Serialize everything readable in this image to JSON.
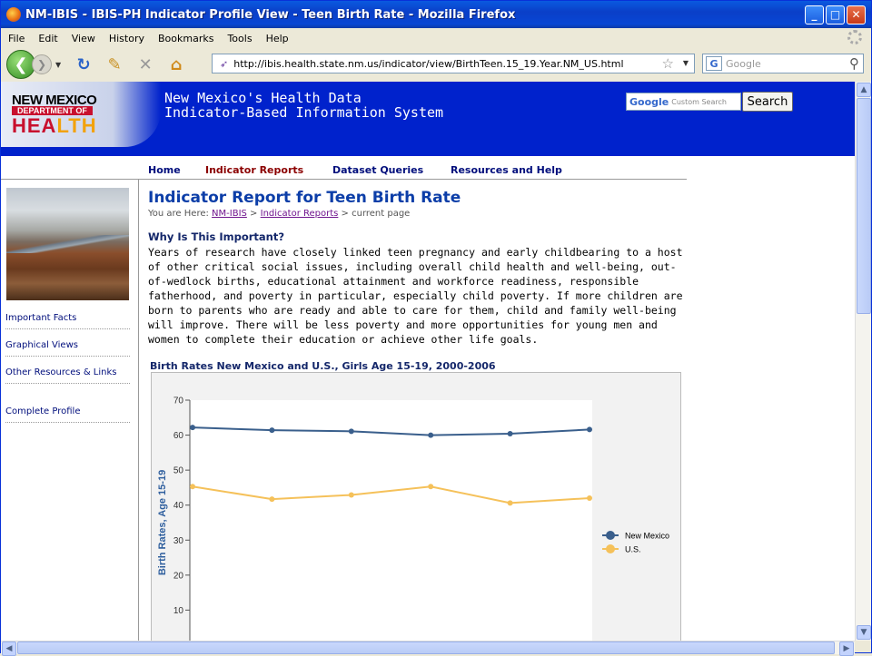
{
  "window": {
    "title": "NM-IBIS - IBIS-PH Indicator Profile View - Teen Birth Rate - Mozilla Firefox"
  },
  "menu": [
    "File",
    "Edit",
    "View",
    "History",
    "Bookmarks",
    "Tools",
    "Help"
  ],
  "toolbar": {
    "url": "http://ibis.health.state.nm.us/indicator/view/BirthTeen.15_19.Year.NM_US.html",
    "search_placeholder": "Google"
  },
  "banner": {
    "logo_line1": "NEW MEXICO",
    "logo_line2": "DEPARTMENT OF",
    "logo_line3a": "HEA",
    "logo_line3b": "LTH",
    "title_line1": "New Mexico's Health Data",
    "title_line2": "Indicator-Based Information System",
    "custom_search_label": "Google",
    "custom_search_text": "Custom Search",
    "search_button": "Search"
  },
  "nav": {
    "home": "Home",
    "indicator_reports": "Indicator Reports",
    "dataset_queries": "Dataset Queries",
    "resources": "Resources and Help"
  },
  "sidebar": {
    "items": [
      "Important Facts",
      "Graphical Views",
      "Other Resources & Links",
      "Complete Profile"
    ]
  },
  "main": {
    "title": "Indicator Report for Teen Birth Rate",
    "crumb_prefix": "You are Here:",
    "crumb_link1": "NM-IBIS",
    "crumb_link2": "Indicator Reports",
    "crumb_suffix": "> current page",
    "why_heading": "Why Is This Important?",
    "why_text": "Years of research have closely linked teen pregnancy and early childbearing to a host of other critical social issues, including overall child health and well-being, out-of-wedlock births, educational attainment and workforce readiness, responsible fatherhood, and poverty in particular, especially child poverty. If more children are born to parents who are ready and able to care for them, child and family well-being will improve. There will be less poverty and more opportunities for young men and women to complete their education or achieve other life goals."
  },
  "chart_data": {
    "type": "line",
    "title": "Birth Rates New Mexico and U.S., Girls Age 15-19, 2000-2006",
    "ylabel": "Birth Rates, Age 15-19",
    "ylim": [
      0,
      70
    ],
    "yticks": [
      10,
      20,
      30,
      40,
      50,
      60,
      70
    ],
    "x_index": [
      1,
      2,
      3,
      4,
      5,
      6
    ],
    "series": [
      {
        "name": "New Mexico",
        "color": "#3a5f8c",
        "values": [
          62.2,
          61.4,
          61.1,
          60.0,
          60.4,
          61.6
        ]
      },
      {
        "name": "U.S.",
        "color": "#f5c15a",
        "values": [
          45.3,
          41.7,
          42.9,
          45.3,
          40.6,
          42.0
        ]
      }
    ],
    "legend": "right"
  },
  "colors": {
    "banner": "#0022cc",
    "accent_title": "#0c3ea8"
  }
}
